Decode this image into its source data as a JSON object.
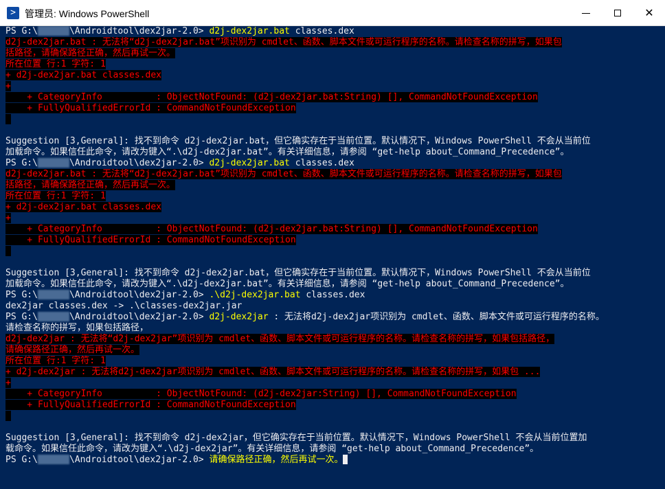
{
  "window": {
    "title": "管理员: Windows PowerShell",
    "icon": "powershell-icon",
    "controls": {
      "minimize": "minimize-icon",
      "maximize": "maximize-icon",
      "close": "close-icon"
    }
  },
  "colors": {
    "background": "#012456",
    "error_fg": "#ff0000",
    "error_bg": "#000000",
    "command": "#ffff00",
    "text": "#eeedf0"
  },
  "console": {
    "prompt_dir": "\\Androidtool\\dex2jar-2.0>",
    "lines": [
      {
        "type": "prompt",
        "cmd": "d2j-dex2jar.bat",
        "args": " classes.dex"
      },
      {
        "type": "err",
        "text": "d2j-dex2jar.bat : 无法将“d2j-dex2jar.bat”项识别为 cmdlet、函数、脚本文件或可运行程序的名称。请检查名称的拼写，如果包"
      },
      {
        "type": "err",
        "text": "括路径，请确保路径正确，然后再试一次。"
      },
      {
        "type": "err",
        "text": "所在位置 行:1 字符: 1"
      },
      {
        "type": "err",
        "text": "+ d2j-dex2jar.bat classes.dex"
      },
      {
        "type": "err",
        "text": "+"
      },
      {
        "type": "err",
        "text": "    + CategoryInfo          : ObjectNotFound: (d2j-dex2jar.bat:String) [], CommandNotFoundException"
      },
      {
        "type": "err",
        "text": "    + FullyQualifiedErrorId : CommandNotFoundException"
      },
      {
        "type": "err",
        "text": " "
      },
      {
        "type": "blank",
        "text": ""
      },
      {
        "type": "text",
        "text": "Suggestion [3,General]: 找不到命令 d2j-dex2jar.bat，但它确实存在于当前位置。默认情况下，Windows PowerShell 不会从当前位"
      },
      {
        "type": "text",
        "text": "加载命令。如果信任此命令，请改为键入“.\\d2j-dex2jar.bat”。有关详细信息，请参阅 “get-help about_Command_Precedence”。"
      },
      {
        "type": "prompt",
        "cmd": "d2j-dex2jar.bat",
        "args": " classes.dex"
      },
      {
        "type": "err",
        "text": "d2j-dex2jar.bat : 无法将“d2j-dex2jar.bat”项识别为 cmdlet、函数、脚本文件或可运行程序的名称。请检查名称的拼写，如果包"
      },
      {
        "type": "err",
        "text": "括路径，请确保路径正确，然后再试一次。"
      },
      {
        "type": "err",
        "text": "所在位置 行:1 字符: 1"
      },
      {
        "type": "err",
        "text": "+ d2j-dex2jar.bat classes.dex"
      },
      {
        "type": "err",
        "text": "+"
      },
      {
        "type": "err",
        "text": "    + CategoryInfo          : ObjectNotFound: (d2j-dex2jar.bat:String) [], CommandNotFoundException"
      },
      {
        "type": "err",
        "text": "    + FullyQualifiedErrorId : CommandNotFoundException"
      },
      {
        "type": "err",
        "text": " "
      },
      {
        "type": "blank",
        "text": ""
      },
      {
        "type": "text",
        "text": "Suggestion [3,General]: 找不到命令 d2j-dex2jar.bat，但它确实存在于当前位置。默认情况下，Windows PowerShell 不会从当前位"
      },
      {
        "type": "text",
        "text": "加载命令。如果信任此命令，请改为键入“.\\d2j-dex2jar.bat”。有关详细信息，请参阅 “get-help about_Command_Precedence”。"
      },
      {
        "type": "prompt",
        "cmd": ".\\d2j-dex2jar.bat",
        "args": " classes.dex"
      },
      {
        "type": "text",
        "text": "dex2jar classes.dex -> .\\classes-dex2jar.jar"
      },
      {
        "type": "prompt",
        "cmd": "d2j-dex2jar",
        "args": " : 无法将d2j-dex2jar项识别为 cmdlet、函数、脚本文件或可运行程序的名称。"
      },
      {
        "type": "text",
        "text": "请检查名称的拼写，如果包括路径，"
      },
      {
        "type": "err",
        "text": "d2j-dex2jar : 无法将“d2j-dex2jar”项识别为 cmdlet、函数、脚本文件或可运行程序的名称。请检查名称的拼写，如果包括路径，"
      },
      {
        "type": "err",
        "text": "请确保路径正确，然后再试一次。"
      },
      {
        "type": "err",
        "text": "所在位置 行:1 字符: 1"
      },
      {
        "type": "err",
        "text": "+ d2j-dex2jar : 无法将d2j-dex2jar项识别为 cmdlet、函数、脚本文件或可运行程序的名称。请检查名称的拼写，如果包 ..."
      },
      {
        "type": "err",
        "text": "+"
      },
      {
        "type": "err",
        "text": "    + CategoryInfo          : ObjectNotFound: (d2j-dex2jar:String) [], CommandNotFoundException"
      },
      {
        "type": "err",
        "text": "    + FullyQualifiedErrorId : CommandNotFoundException"
      },
      {
        "type": "err",
        "text": " "
      },
      {
        "type": "blank",
        "text": ""
      },
      {
        "type": "text",
        "text": "Suggestion [3,General]: 找不到命令 d2j-dex2jar，但它确实存在于当前位置。默认情况下，Windows PowerShell 不会从当前位置加"
      },
      {
        "type": "text",
        "text": "载命令。如果信任此命令，请改为键入“.\\d2j-dex2jar”。有关详细信息，请参阅 “get-help about_Command_Precedence”。"
      },
      {
        "type": "prompt",
        "cmd": "请确保路径正确，然后再试一次。",
        "args": "",
        "cursor": true
      }
    ]
  }
}
